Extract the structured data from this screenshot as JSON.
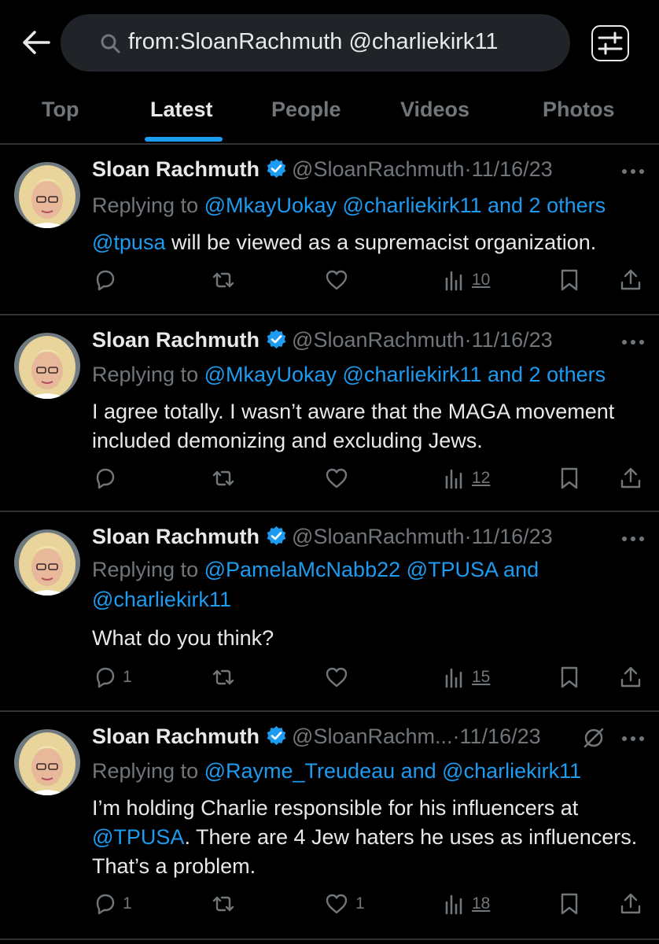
{
  "search": {
    "query": "from:SloanRachmuth @charliekirk11"
  },
  "tabs": [
    {
      "label": "Top"
    },
    {
      "label": "Latest"
    },
    {
      "label": "People"
    },
    {
      "label": "Videos"
    },
    {
      "label": "Photos"
    }
  ],
  "tweets": [
    {
      "display_name": "Sloan Rachmuth",
      "handle": "@SloanRachmuth",
      "date": "11/16/23",
      "reply_prefix": "Replying to ",
      "reply_links": "@MkayUokay @charliekirk11 and 2 others",
      "body_link": "@tpusa",
      "body": " will be viewed as a supremacist organization.",
      "replies": "",
      "likes": "",
      "views": "10"
    },
    {
      "display_name": "Sloan Rachmuth",
      "handle": "@SloanRachmuth",
      "date": "11/16/23",
      "reply_prefix": "Replying to ",
      "reply_links": "@MkayUokay @charliekirk11 and 2 others",
      "body": "I agree totally. I wasn’t aware that the MAGA movement included demonizing and excluding Jews.",
      "replies": "",
      "likes": "",
      "views": "12"
    },
    {
      "display_name": "Sloan Rachmuth",
      "handle": "@SloanRachmuth",
      "date": "11/16/23",
      "reply_prefix": "Replying to ",
      "reply_links": "@PamelaMcNabb22 @TPUSA and @charliekirk11",
      "body": "What do you think?",
      "replies": "1",
      "likes": "",
      "views": "15"
    },
    {
      "display_name": "Sloan Rachmuth",
      "handle": "@SloanRachm...",
      "date": "11/16/23",
      "reply_prefix": "Replying to ",
      "reply_links": "@Rayme_Treudeau and @charliekirk11",
      "body_pre": "I’m holding Charlie responsible for his influencers at ",
      "body_link": "@TPUSA",
      "body": ". There are 4 Jew haters he uses as influencers. That’s a problem.",
      "replies": "1",
      "likes": "1",
      "views": "18"
    }
  ],
  "sep": "·",
  "colors": {
    "background": "#000000",
    "accent": "#1d9bf0",
    "text": "#e7e9ea",
    "muted": "#71767b",
    "divider": "#2f3336"
  },
  "icons": [
    "back-arrow-icon",
    "search-icon",
    "filter-icon",
    "verified-badge-icon",
    "more-icon",
    "reply-icon",
    "retweet-icon",
    "like-icon",
    "views-icon",
    "bookmark-icon",
    "share-icon",
    "mute-icon"
  ]
}
